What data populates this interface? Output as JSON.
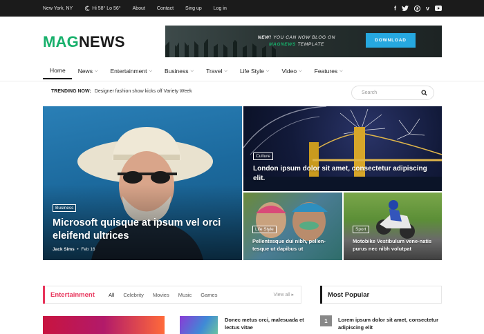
{
  "topbar": {
    "location": "New York, NY",
    "weather": "Hi 58° Lo 56°",
    "links": [
      "About",
      "Contact",
      "Sing up",
      "Log in"
    ],
    "social_icons": [
      "facebook-icon",
      "twitter-icon",
      "pinterest-icon",
      "vimeo-icon",
      "youtube-icon"
    ]
  },
  "brand": {
    "mag": "MAG",
    "news": "NEWS",
    "accent": "#17b06b"
  },
  "banner": {
    "line1_new": "NEW!",
    "line1_rest": "YOU CAN NOW BLOG ON",
    "line2_brand": "MAGNEWS",
    "line2_rest": "TEMPLATE",
    "button": "DOWNLOAD",
    "button_color": "#26a8e0"
  },
  "nav": {
    "items": [
      "Home",
      "News",
      "Entertainment",
      "Business",
      "Travel",
      "Life Style",
      "Video",
      "Features"
    ]
  },
  "trending": {
    "label": "TRENDING NOW:",
    "text": "Designer fashion show kicks off Variety Week"
  },
  "search": {
    "placeholder": "Search"
  },
  "featured": {
    "big": {
      "tag": "Business",
      "title": "Microsoft quisque at ipsum vel orci eleifend ultrices",
      "author": "Jack Sims",
      "date": "Feb 16"
    },
    "culture": {
      "tag": "Culture",
      "title": "London ipsum dolor sit amet, consectetur adipiscing elit."
    },
    "life": {
      "tag": "Life Style",
      "title": "Pellentesque dui nibh, pellen-tesque ut dapibus ut"
    },
    "sport": {
      "tag": "Sport",
      "title": "Motobike Vestibulum vene-natis purus nec nibh volutpat"
    }
  },
  "entertainment": {
    "title": "Entertainment",
    "accent": "#e8345b",
    "tabs": [
      "All",
      "Celebrity",
      "Movies",
      "Music",
      "Games"
    ],
    "view_all": "View all",
    "first_article": "Donec metus orci, malesuada et lectus vitae"
  },
  "popular": {
    "title": "Most Popular",
    "items": [
      {
        "rank": "1",
        "title": "Lorem ipsum dolor sit amet, consectetur adipiscing elit"
      }
    ]
  }
}
